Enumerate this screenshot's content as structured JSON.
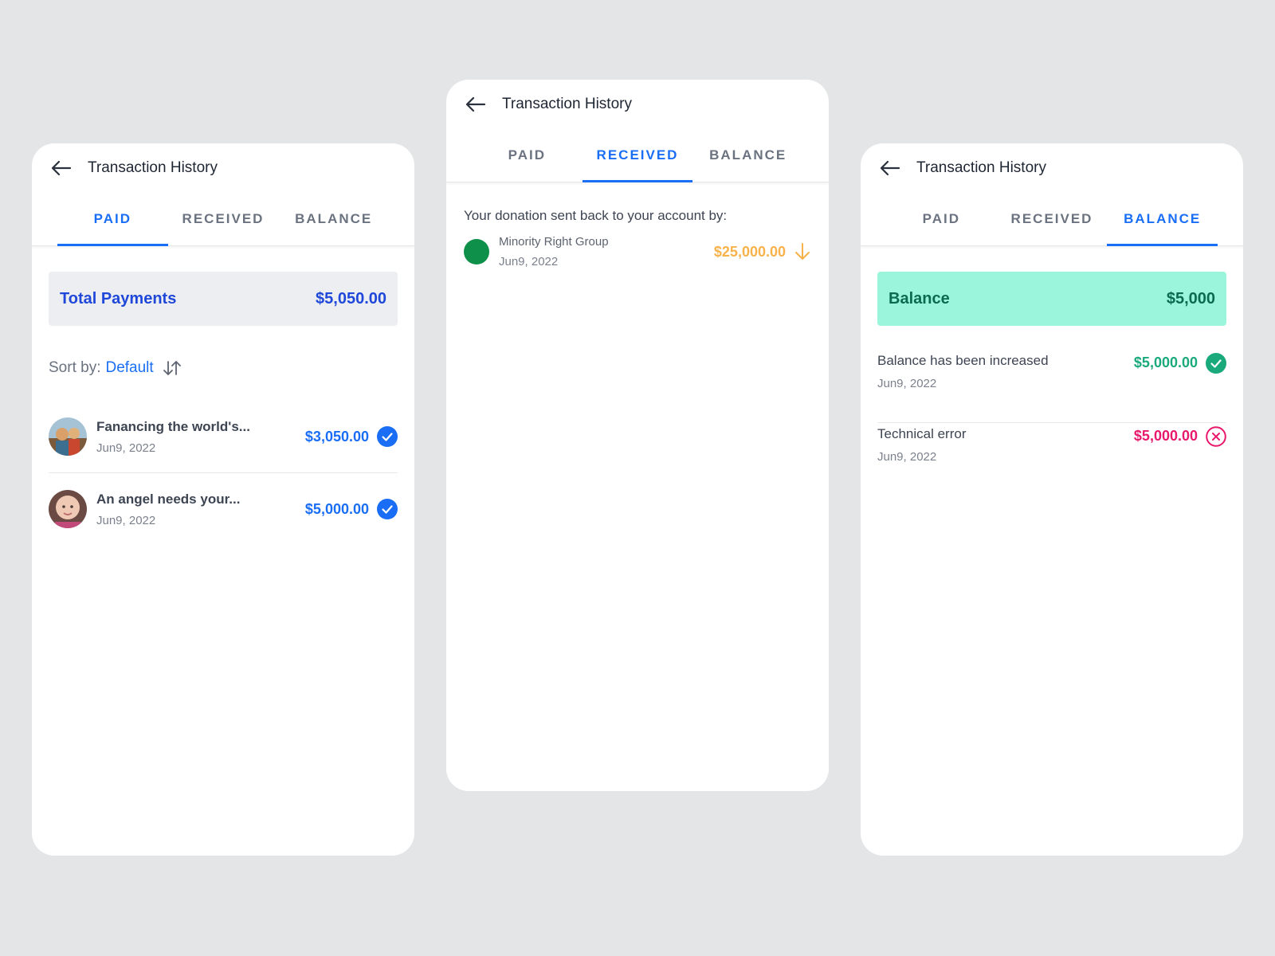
{
  "colors": {
    "accent": "#1a6ef5",
    "balance_bg": "#9bf5dc",
    "success": "#19a97b",
    "error": "#e8196c",
    "received": "#f8b24a"
  },
  "header": {
    "title": "Transaction History"
  },
  "tabs": {
    "paid": "PAID",
    "received": "RECEIVED",
    "balance": "BALANCE"
  },
  "paid": {
    "summary_label": "Total Payments",
    "summary_value": "$5,050.00",
    "sort_label": "Sort by:",
    "sort_value": "Default",
    "items": [
      {
        "title": "Fanancing the world's...",
        "date": "Jun9, 2022",
        "amount": "$3,050.00"
      },
      {
        "title": "An angel needs your...",
        "date": "Jun9, 2022",
        "amount": "$5,000.00"
      }
    ]
  },
  "received": {
    "intro": "Your donation sent back to your account by:",
    "items": [
      {
        "title": "Minority Right Group",
        "date": "Jun9, 2022",
        "amount": "$25,000.00"
      }
    ]
  },
  "balance": {
    "summary_label": "Balance",
    "summary_value": "$5,000",
    "items": [
      {
        "title": "Balance has been increased",
        "date": "Jun9, 2022",
        "amount": "$5,000.00",
        "status": "success"
      },
      {
        "title": "Technical error",
        "date": "Jun9, 2022",
        "amount": "$5,000.00",
        "status": "error"
      }
    ]
  }
}
